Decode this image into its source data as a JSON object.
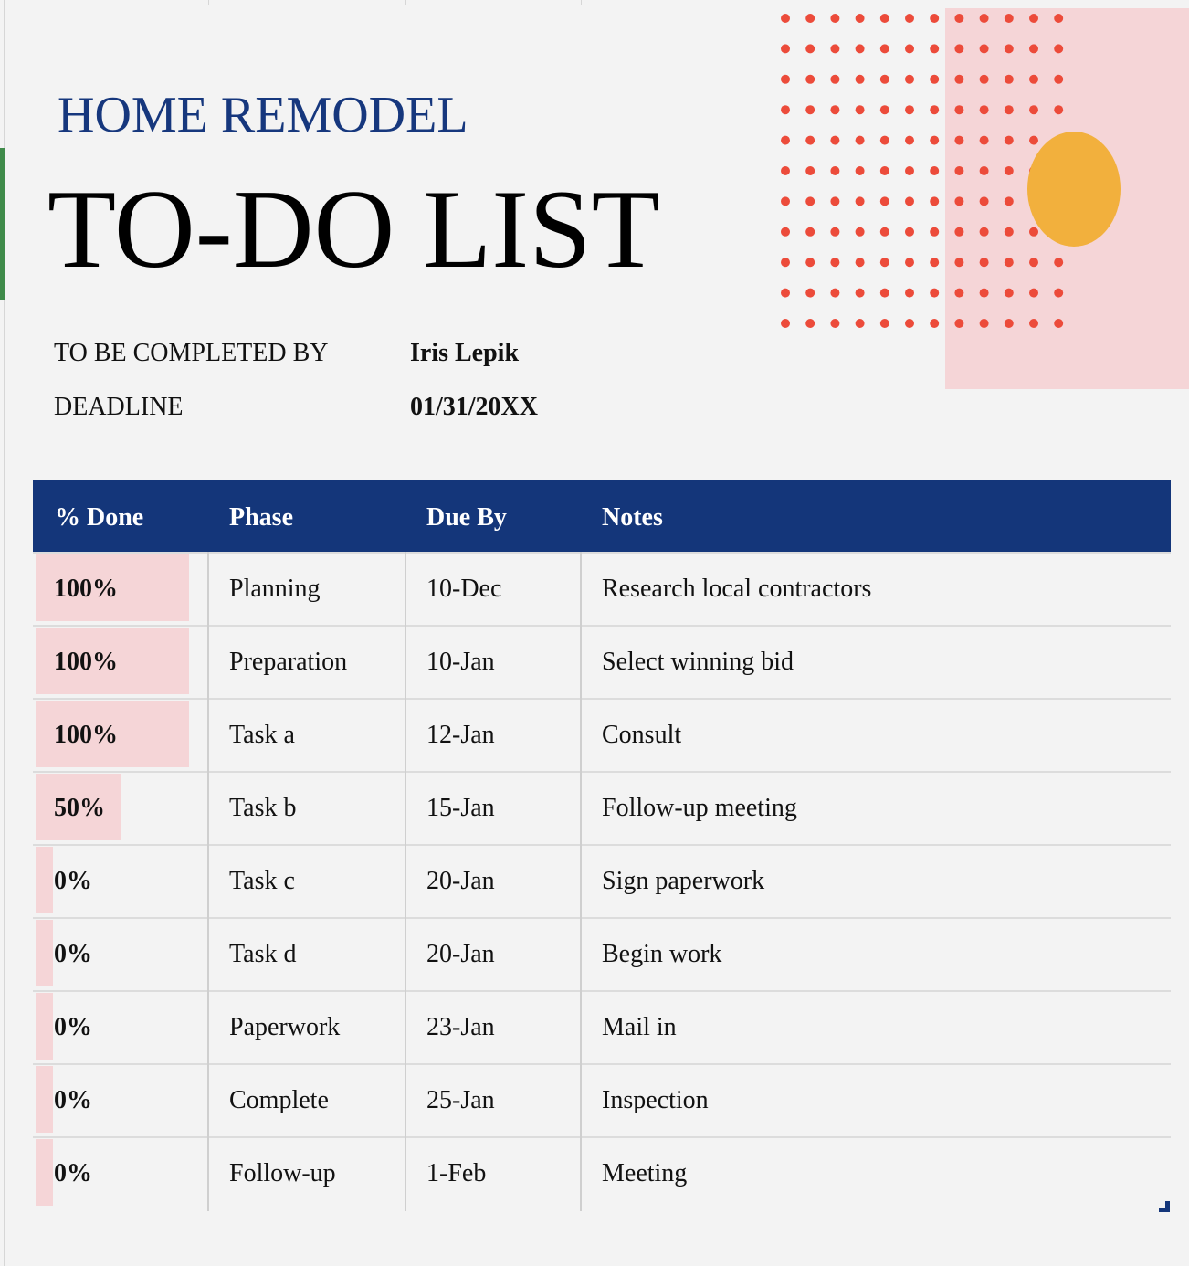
{
  "header": {
    "subtitle": "HOME REMODEL",
    "title": "TO-DO LIST"
  },
  "meta": {
    "completed_by_label": "TO BE COMPLETED BY",
    "completed_by_value": "Iris Lepik",
    "deadline_label": "DEADLINE",
    "deadline_value": "01/31/20XX"
  },
  "table": {
    "columns": [
      "% Done",
      "Phase",
      "Due By",
      "Notes"
    ],
    "rows": [
      {
        "done": "100%",
        "done_fraction": 1.0,
        "phase": "Planning",
        "due": "10-Dec",
        "notes": "Research local contractors"
      },
      {
        "done": "100%",
        "done_fraction": 1.0,
        "phase": "Preparation",
        "due": "10-Jan",
        "notes": "Select winning bid"
      },
      {
        "done": "100%",
        "done_fraction": 1.0,
        "phase": "Task a",
        "due": "12-Jan",
        "notes": "Consult"
      },
      {
        "done": "50%",
        "done_fraction": 0.5,
        "phase": "Task b",
        "due": "15-Jan",
        "notes": "Follow-up meeting"
      },
      {
        "done": "0%",
        "done_fraction": 0.0,
        "phase": "Task c",
        "due": "20-Jan",
        "notes": "Sign paperwork"
      },
      {
        "done": "0%",
        "done_fraction": 0.0,
        "phase": "Task d",
        "due": "20-Jan",
        "notes": "Begin work"
      },
      {
        "done": "0%",
        "done_fraction": 0.0,
        "phase": "Paperwork",
        "due": "23-Jan",
        "notes": "Mail in"
      },
      {
        "done": "0%",
        "done_fraction": 0.0,
        "phase": "Complete",
        "due": "25-Jan",
        "notes": "Inspection"
      },
      {
        "done": "0%",
        "done_fraction": 0.0,
        "phase": "Follow-up",
        "due": "1-Feb",
        "notes": "Meeting"
      }
    ]
  },
  "colors": {
    "header_blue": "#14367a",
    "title_blue": "#16377d",
    "pink": "#f5d5d7",
    "dot_red": "#ec4b3a",
    "circle_orange": "#f2b03d",
    "active_marker_green": "#3f8b4a"
  }
}
